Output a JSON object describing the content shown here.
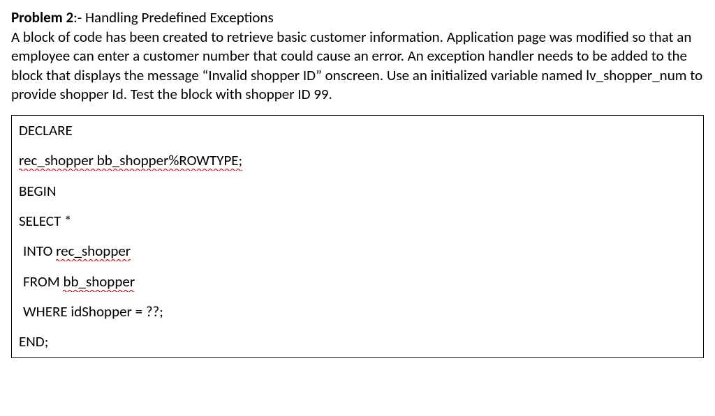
{
  "header": {
    "title": "Problem 2",
    "separator": ":- ",
    "subtitle": "Handling Predefined Exceptions"
  },
  "body": "A block of code has been created to retrieve basic customer information. Application page was modified so that an employee can enter a customer number that could cause an error. An exception handler needs to be added to the block that displays the message “Invalid shopper ID” onscreen. Use an initialized variable named lv_shopper_num to provide shopper Id. Test the block with shopper ID 99.",
  "code": {
    "lines": [
      {
        "segments": [
          {
            "text": "DECLARE",
            "squiggle": false
          }
        ],
        "indent": false
      },
      {
        "segments": [
          {
            "text": "rec_shopper bb_shopper%ROWTYPE;",
            "squiggle": true
          }
        ],
        "indent": false
      },
      {
        "segments": [
          {
            "text": "BEGIN",
            "squiggle": false
          }
        ],
        "indent": false
      },
      {
        "segments": [
          {
            "text": "SELECT *",
            "squiggle": false
          }
        ],
        "indent": false
      },
      {
        "segments": [
          {
            "text": "INTO ",
            "squiggle": false
          },
          {
            "text": "rec_shopper",
            "squiggle": true
          }
        ],
        "indent": true
      },
      {
        "segments": [
          {
            "text": "FROM ",
            "squiggle": false
          },
          {
            "text": "bb_shopper",
            "squiggle": true
          }
        ],
        "indent": true
      },
      {
        "segments": [
          {
            "text": "WHERE idShopper = ??;",
            "squiggle": false
          }
        ],
        "indent": true
      },
      {
        "segments": [
          {
            "text": "END;",
            "squiggle": false
          }
        ],
        "indent": false
      }
    ]
  }
}
